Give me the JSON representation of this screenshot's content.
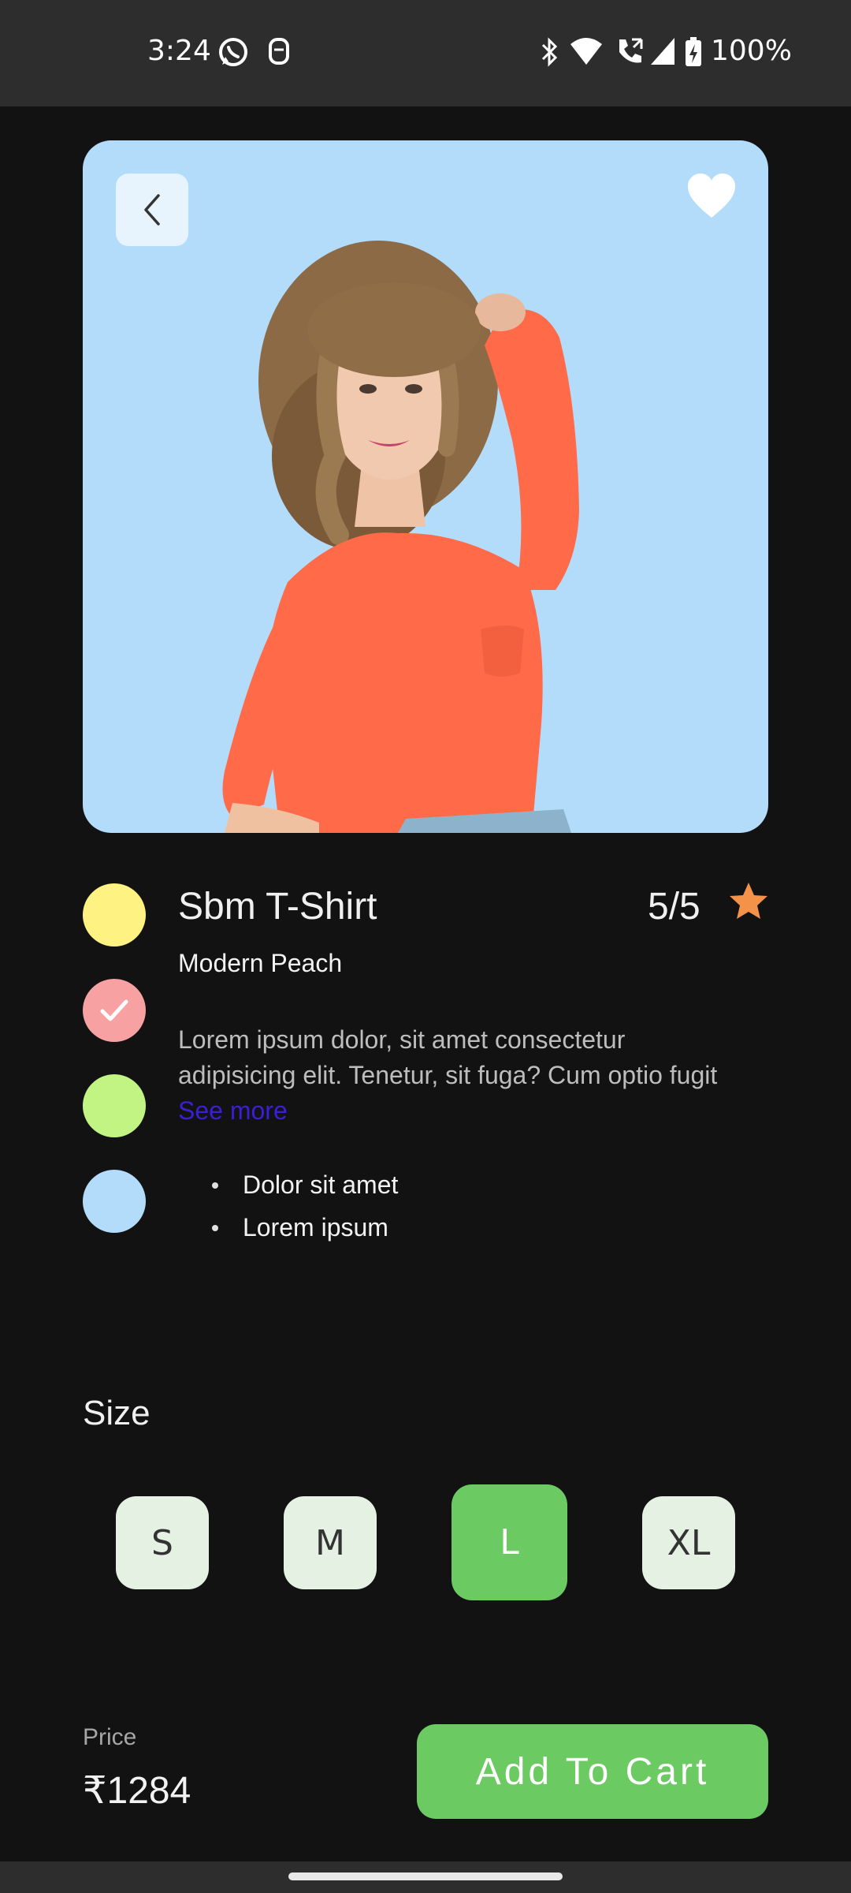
{
  "status_bar": {
    "time": "3:24",
    "battery": "100%",
    "icons": [
      "whatsapp-icon",
      "notification-icon",
      "bluetooth-icon",
      "wifi-icon",
      "call-icon",
      "signal-icon",
      "battery-icon"
    ]
  },
  "product": {
    "name": "Sbm T-Shirt",
    "color_name": "Modern Peach",
    "rating": "5/5",
    "description": "Lorem ipsum dolor, sit amet consectetur adipisicing elit. Tenetur, sit fuga? Cum optio fugit",
    "see_more": "See more",
    "bullets": [
      "Dolor sit amet",
      "Lorem ipsum"
    ],
    "hero_bg": "#b3dcfb"
  },
  "swatches": [
    {
      "color": "#fef382",
      "selected": false
    },
    {
      "color": "#f8a1a2",
      "selected": true
    },
    {
      "color": "#c2f483",
      "selected": false
    },
    {
      "color": "#b3dcfb",
      "selected": false
    }
  ],
  "size": {
    "label": "Size",
    "options": [
      "S",
      "M",
      "L",
      "XL"
    ],
    "selected": "L"
  },
  "price": {
    "label": "Price",
    "value": "₹1284"
  },
  "cart_button": "Add To Cart",
  "colors": {
    "accent": "#6cca63",
    "background": "#121212",
    "star": "#f5924a",
    "link": "#3a1fd6"
  }
}
